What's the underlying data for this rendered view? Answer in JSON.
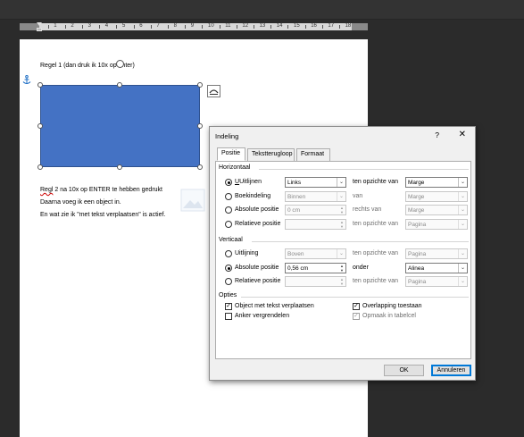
{
  "ruler": {
    "numbers": [
      "1",
      "2",
      "3",
      "4",
      "5",
      "6",
      "7",
      "8",
      "9",
      "10",
      "11",
      "12",
      "13",
      "14",
      "15",
      "16",
      "17",
      "18"
    ]
  },
  "document": {
    "line1": "Regel 1  (dan druk ik 10x op enter)",
    "line2_word1": "Regl",
    "line2_rest": " 2 na 10x op ENTER te hebben gedrukt",
    "line3": "Daarna voeg ik een object in.",
    "line4": "En wat zie ik \"met tekst verplaatsen\" is actief.",
    "shape_color": "#4472C4"
  },
  "dialog": {
    "title": "Indeling",
    "help": "?",
    "close": "✕",
    "tabs": [
      "Positie",
      "Tekstterugloop",
      "Formaat"
    ],
    "horizontal": {
      "heading": "Horizontaal",
      "rows": [
        {
          "label": "Uitlijnen",
          "value": "Links",
          "rel_label": "ten opzichte van",
          "rel_value": "Marge",
          "selected": true
        },
        {
          "label": "Boekindeling",
          "value": "Binnen",
          "rel_label": "van",
          "rel_value": "Marge",
          "selected": false
        },
        {
          "label": "Absolute positie",
          "value": "0 cm",
          "rel_label": "rechts van",
          "rel_value": "Marge",
          "selected": false
        },
        {
          "label": "Relatieve positie",
          "value": "",
          "rel_label": "ten opzichte van",
          "rel_value": "Pagina",
          "selected": false
        }
      ]
    },
    "vertical": {
      "heading": "Verticaal",
      "rows": [
        {
          "label": "Uitlijning",
          "value": "Boven",
          "rel_label": "ten opzichte van",
          "rel_value": "Pagina",
          "selected": false
        },
        {
          "label": "Absolute positie",
          "value": "0,56 cm",
          "rel_label": "onder",
          "rel_value": "Alinea",
          "selected": true
        },
        {
          "label": "Relatieve positie",
          "value": "",
          "rel_label": "ten opzichte van",
          "rel_value": "Pagina",
          "selected": false
        }
      ]
    },
    "options": {
      "heading": "Opties",
      "move_with_text": {
        "label": "Object met tekst verplaatsen",
        "checked": true
      },
      "lock_anchor": {
        "label": "Anker vergrendelen",
        "checked": false
      },
      "allow_overlap": {
        "label": "Overlapping toestaan",
        "checked": true
      },
      "layout_in_cell": {
        "label": "Opmaak in tabelcel",
        "checked": true
      }
    },
    "ok_label": "OK",
    "cancel_label": "Annuleren"
  }
}
